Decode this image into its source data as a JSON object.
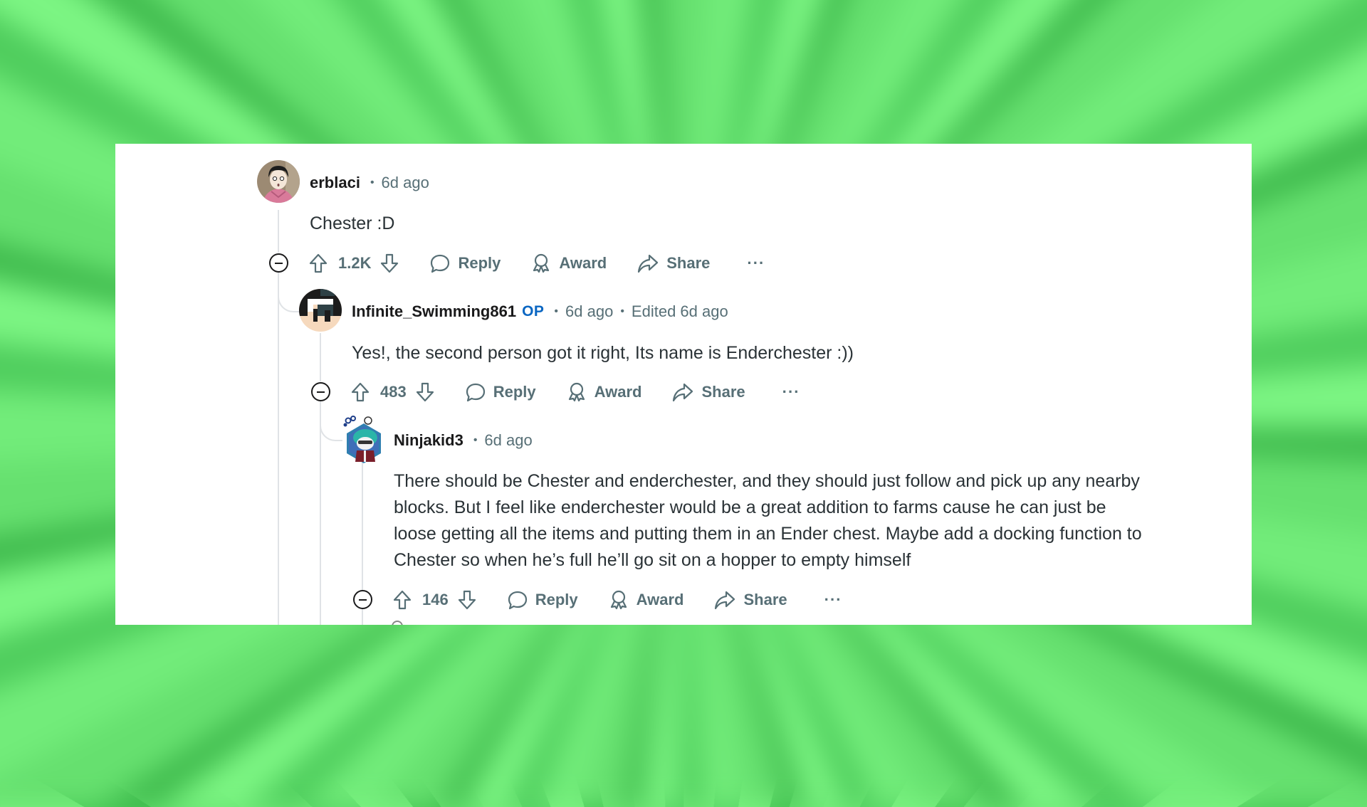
{
  "colors": {
    "background_green": "#6fe877",
    "card": "#ffffff",
    "username": "#1a1a1b",
    "meta": "#576f76",
    "body": "#2a3236",
    "op_badge": "#0a66c2",
    "thread_line": "#e0e3e6"
  },
  "comments": [
    {
      "username": "erblaci",
      "op": false,
      "separator": "•",
      "time": "6d ago",
      "edited": null,
      "avatar": "anime-boy-pink-hoodie-avatar",
      "body": [
        "Chester :D"
      ],
      "votes": "1.2K",
      "actions": {
        "reply": "Reply",
        "award": "Award",
        "share": "Share",
        "more": "···"
      }
    },
    {
      "username": "Infinite_Swimming861",
      "op": true,
      "op_label": "OP",
      "separator": "•",
      "time": "6d ago",
      "edited": "Edited 6d ago",
      "avatar": "pixel-art-avatar",
      "body": [
        "Yes!, the second person got it right, Its name is Enderchester :))"
      ],
      "votes": "483",
      "actions": {
        "reply": "Reply",
        "award": "Award",
        "share": "Share",
        "more": "···"
      }
    },
    {
      "username": "Ninjakid3",
      "op": false,
      "separator": "•",
      "time": "6d ago",
      "edited": null,
      "avatar": "snoo-nft-teal-hair-avatar",
      "body": [
        "There should be Chester and enderchester, and they should just follow and pick up any nearby",
        "blocks. But I feel like enderchester would be a great addition to farms cause he can just be",
        "loose getting all the items and putting them in an Ender chest. Maybe add a docking function to",
        "Chester so when he’s full he’ll go sit on a hopper to empty himself"
      ],
      "votes": "146",
      "actions": {
        "reply": "Reply",
        "award": "Award",
        "share": "Share",
        "more": "···"
      }
    }
  ]
}
